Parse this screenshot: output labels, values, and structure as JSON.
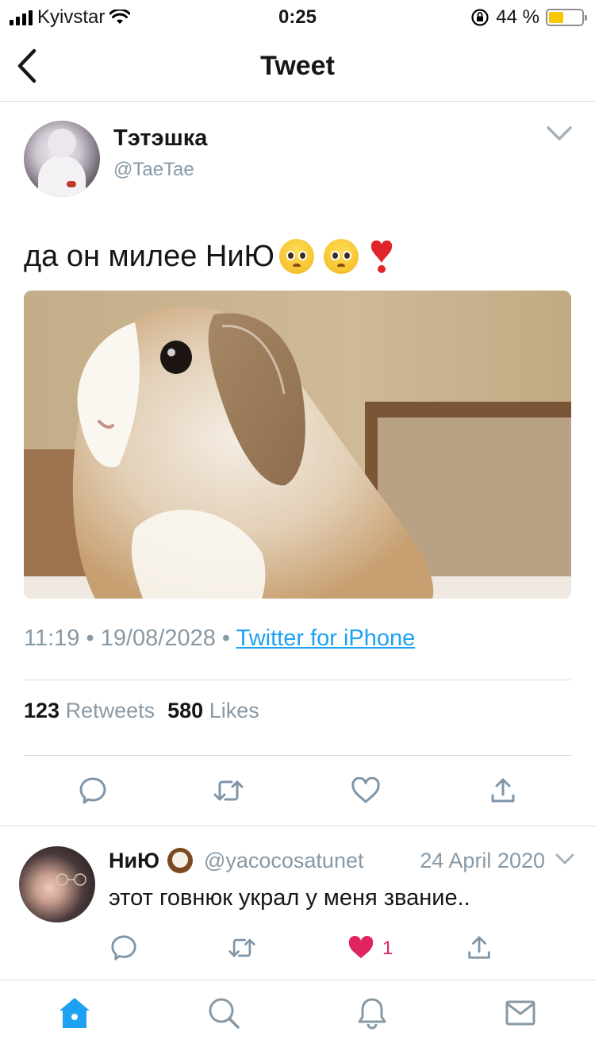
{
  "status_bar": {
    "carrier": "Kyivstar",
    "time": "0:25",
    "battery_percent": "44 %",
    "battery_level": 0.44,
    "battery_color": "#f5c800"
  },
  "nav": {
    "title": "Tweet",
    "back_icon": "chevron-left-icon"
  },
  "tweet": {
    "author": {
      "name": "Тэтэшка",
      "handle": "@TaeTae"
    },
    "text": "да он милее НиЮ",
    "emojis": [
      "pleading-face-icon",
      "pleading-face-icon",
      "heart-exclamation-icon"
    ],
    "media": {
      "description": "lop-eared rabbit photo"
    },
    "time": "11:19",
    "date": "19/08/2028",
    "separator": "•",
    "source": "Twitter for iPhone",
    "stats": {
      "retweets_count": "123",
      "retweets_label": "Retweets",
      "likes_count": "580",
      "likes_label": "Likes"
    },
    "actions": [
      "reply-icon",
      "retweet-icon",
      "like-icon",
      "share-icon"
    ]
  },
  "reply": {
    "name": "НиЮ",
    "handle": "@yacocosatunet",
    "date": "24 April 2020",
    "text": "этот говнюк украл у меня звание..",
    "like_count": "1",
    "liked": true,
    "like_color": "#e0245e"
  },
  "tabbar": {
    "items": [
      "home-icon",
      "search-icon",
      "notifications-icon",
      "messages-icon"
    ],
    "active": "home-icon",
    "accent": "#1da1f2"
  }
}
